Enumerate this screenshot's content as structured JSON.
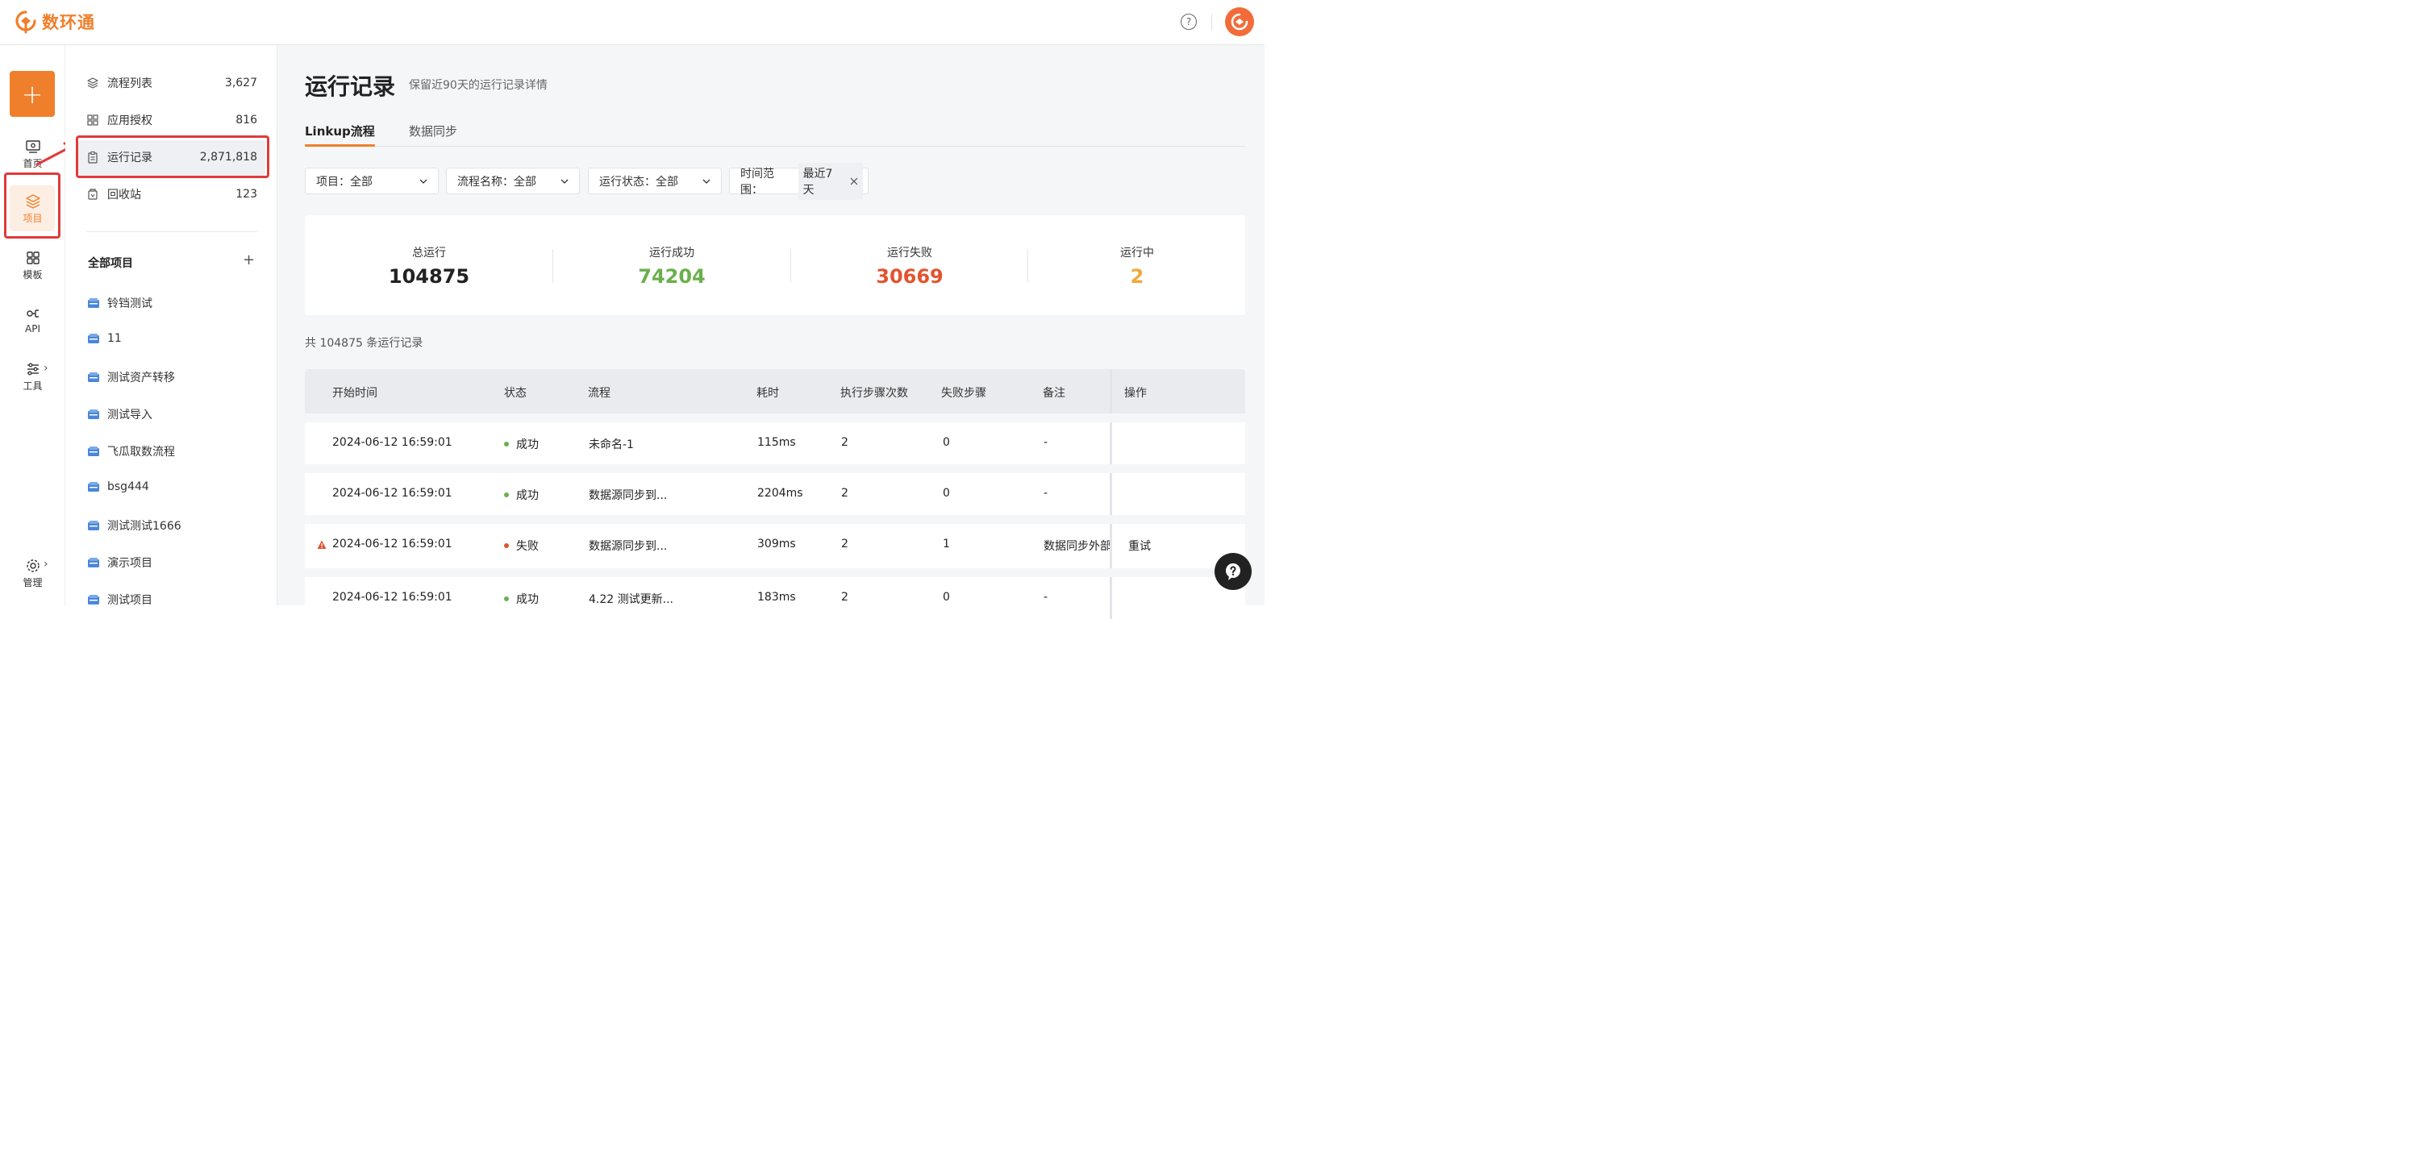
{
  "app": {
    "logo_text": "数环通",
    "brand_color": "#f07f2b"
  },
  "header": {
    "help_icon": "question-circle-icon",
    "avatar_icon": "brand-avatar-icon"
  },
  "rail": {
    "create_label": "+",
    "items": [
      {
        "label": "首页",
        "icon": "monitor-icon"
      },
      {
        "label": "项目",
        "icon": "layers-icon",
        "active": true
      },
      {
        "label": "模板",
        "icon": "grid-icon"
      },
      {
        "label": "API",
        "icon": "api-icon"
      },
      {
        "label": "工具",
        "icon": "sliders-icon"
      },
      {
        "label": "管理",
        "icon": "gear-icon"
      }
    ]
  },
  "sidebar": {
    "menu": [
      {
        "label": "流程列表",
        "count": "3,627",
        "icon": "layers-icon"
      },
      {
        "label": "应用授权",
        "count": "816",
        "icon": "grid-icon"
      },
      {
        "label": "运行记录",
        "count": "2,871,818",
        "icon": "clipboard-icon",
        "active": true
      },
      {
        "label": "回收站",
        "count": "123",
        "icon": "trash-icon"
      }
    ],
    "all_projects_label": "全部项目",
    "add_label": "+",
    "projects": [
      "铃铛测试",
      "11",
      "测试资产转移",
      "测试导入",
      "飞瓜取数流程",
      "bsg444",
      "测试测试1666",
      "演示项目",
      "测试项目"
    ]
  },
  "main": {
    "title": "运行记录",
    "subtitle": "保留近90天的运行记录详情",
    "tabs": [
      {
        "label": "Linkup流程",
        "active": true
      },
      {
        "label": "数据同步"
      }
    ],
    "filters": {
      "project": "项目：全部",
      "flow_name": "流程名称：全部",
      "status": "运行状态：全部",
      "time_label": "时间范围：",
      "time_value": "最近7天"
    },
    "stats": [
      {
        "label": "总运行",
        "value": "104875",
        "color": "#222222"
      },
      {
        "label": "运行成功",
        "value": "74204",
        "color": "#6ab04c"
      },
      {
        "label": "运行失败",
        "value": "30669",
        "color": "#e2542f"
      },
      {
        "label": "运行中",
        "value": "2",
        "color": "#f0a83a"
      }
    ],
    "record_count": "共 104875 条运行记录",
    "table": {
      "headers": [
        "开始时间",
        "状态",
        "流程",
        "耗时",
        "执行步骤次数",
        "失败步骤",
        "备注",
        "操作"
      ],
      "rows": [
        {
          "time": "2024-06-12 16:59:01",
          "status": "成功",
          "flow": "未命名-1",
          "duration": "115ms",
          "steps": "2",
          "failed": "0",
          "note": "-",
          "action": ""
        },
        {
          "time": "2024-06-12 16:59:01",
          "status": "成功",
          "flow": "数据源同步到...",
          "duration": "2204ms",
          "steps": "2",
          "failed": "0",
          "note": "-",
          "action": ""
        },
        {
          "time": "2024-06-12 16:59:01",
          "status": "失败",
          "flow": "数据源同步到...",
          "duration": "309ms",
          "steps": "2",
          "failed": "1",
          "note": "数据同步外部",
          "action": "重试"
        },
        {
          "time": "2024-06-12 16:59:01",
          "status": "成功",
          "flow": "4.22 测试更新...",
          "duration": "183ms",
          "steps": "2",
          "failed": "0",
          "note": "-",
          "action": ""
        }
      ]
    }
  }
}
